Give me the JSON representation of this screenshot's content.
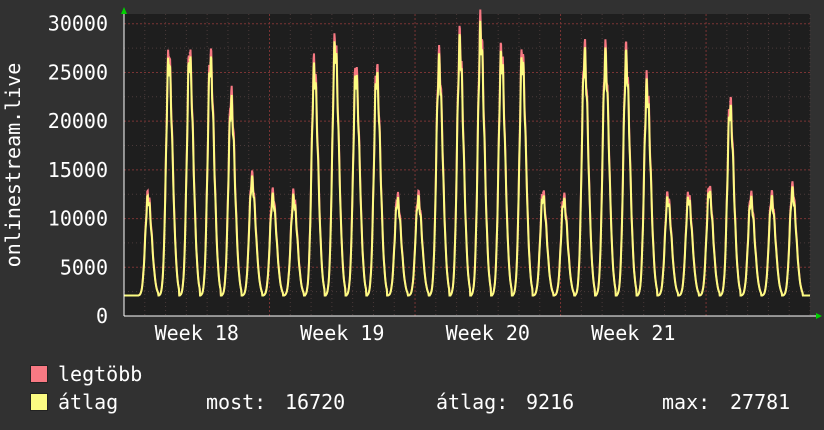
{
  "chart_data": {
    "type": "line",
    "ylabel": "onlinestream.live",
    "ylim": [
      0,
      31000
    ],
    "yticks": [
      0,
      5000,
      10000,
      15000,
      20000,
      25000,
      30000
    ],
    "x_range_days": [
      0,
      33
    ],
    "xticks": [
      {
        "label": "Week 18",
        "day": 3.5
      },
      {
        "label": "Week 19",
        "day": 10.5
      },
      {
        "label": "Week 20",
        "day": 17.5
      },
      {
        "label": "Week 21",
        "day": 24.5
      }
    ],
    "daily_peaks": {
      "x_day": [
        1.15,
        2.15,
        3.15,
        4.15,
        5.15,
        6.15,
        7.15,
        8.15,
        9.15,
        10.15,
        11.15,
        12.15,
        13.15,
        14.15,
        15.15,
        16.15,
        17.15,
        18.15,
        19.15,
        20.15,
        21.15,
        22.15,
        23.15,
        24.15,
        25.15,
        26.15,
        27.15,
        28.15,
        29.15,
        30.15,
        31.15,
        32.15
      ],
      "legtobb": [
        12500,
        26800,
        27000,
        26800,
        22700,
        14300,
        12600,
        12500,
        25900,
        28300,
        25400,
        25400,
        12300,
        12400,
        26400,
        28400,
        30000,
        27300,
        27000,
        12700,
        12300,
        27300,
        27000,
        26900,
        24000,
        12400,
        12500,
        13200,
        22000,
        12400,
        12400,
        13200
      ],
      "atlag": [
        12000,
        26000,
        26300,
        26000,
        21800,
        13800,
        12100,
        12000,
        25000,
        27500,
        24600,
        24600,
        11800,
        11900,
        25600,
        27600,
        28900,
        26500,
        26200,
        12200,
        11800,
        26500,
        26200,
        26100,
        23200,
        11900,
        12000,
        12700,
        21200,
        11900,
        11900,
        12700
      ]
    },
    "trough": 2100,
    "series": [
      {
        "name": "legtöbb",
        "color": "#f87983"
      },
      {
        "name": "átlag",
        "color": "#fcfc82"
      }
    ],
    "stats": {
      "most_label": "most:",
      "most_value": "16720",
      "atlag_label": "átlag:",
      "atlag_value": "9216",
      "max_label": "max:",
      "max_value": "27781"
    },
    "colors": {
      "background": "#313131",
      "plot_background": "#1e1e1e",
      "grid_major": "#7a3434",
      "grid_minor": "#4a3a3a",
      "text": "#ffffff",
      "axis_arrow": "#00d000"
    }
  }
}
